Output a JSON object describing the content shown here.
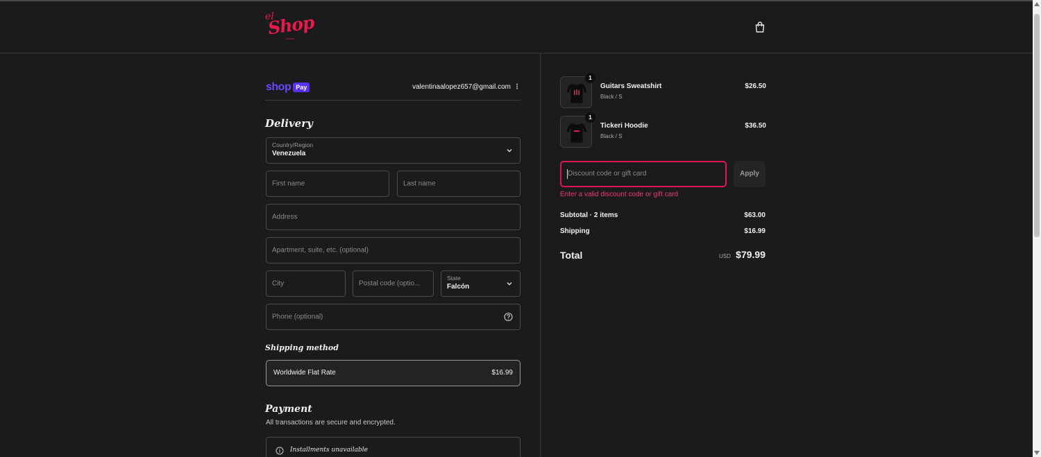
{
  "brand": {
    "logo_prefix": "el",
    "logo_text": "Shop",
    "logo_sub": "tickeri",
    "accent": "#e8194c"
  },
  "header": {
    "cart_icon": "shopping-bag-icon"
  },
  "shoppay": {
    "shop": "shop",
    "pay": "Pay",
    "email": "valentinaalopez657@gmail.com"
  },
  "delivery": {
    "title": "Delivery",
    "country": {
      "label": "Country/Region",
      "value": "Venezuela"
    },
    "first_name": {
      "placeholder": "First name"
    },
    "last_name": {
      "placeholder": "Last name"
    },
    "address": {
      "placeholder": "Address"
    },
    "apartment": {
      "placeholder": "Apartment, suite, etc. (optional)"
    },
    "city": {
      "placeholder": "City"
    },
    "postal": {
      "placeholder": "Postal code (optio..."
    },
    "state": {
      "label": "State",
      "value": "Falcón"
    },
    "phone": {
      "placeholder": "Phone (optional)"
    }
  },
  "shipping_method": {
    "title": "Shipping method",
    "option": {
      "name": "Worldwide Flat Rate",
      "price": "$16.99"
    }
  },
  "payment": {
    "title": "Payment",
    "subtitle": "All transactions are secure and encrypted.",
    "installments": "Installments unavailable"
  },
  "cart": {
    "items": [
      {
        "name": "Guitars Sweatshirt",
        "variant": "Black / S",
        "price": "$26.50",
        "qty": "1"
      },
      {
        "name": "Tickeri Hoodie",
        "variant": "Black / S",
        "price": "$36.50",
        "qty": "1"
      }
    ],
    "discount": {
      "placeholder": "Discount code or gift card",
      "apply": "Apply",
      "error": "Enter a valid discount code or gift card"
    },
    "subtotal_label": "Subtotal · 2 items",
    "subtotal": "$63.00",
    "shipping_label": "Shipping",
    "shipping": "$16.99",
    "total_label": "Total",
    "currency": "USD",
    "total": "$79.99"
  }
}
